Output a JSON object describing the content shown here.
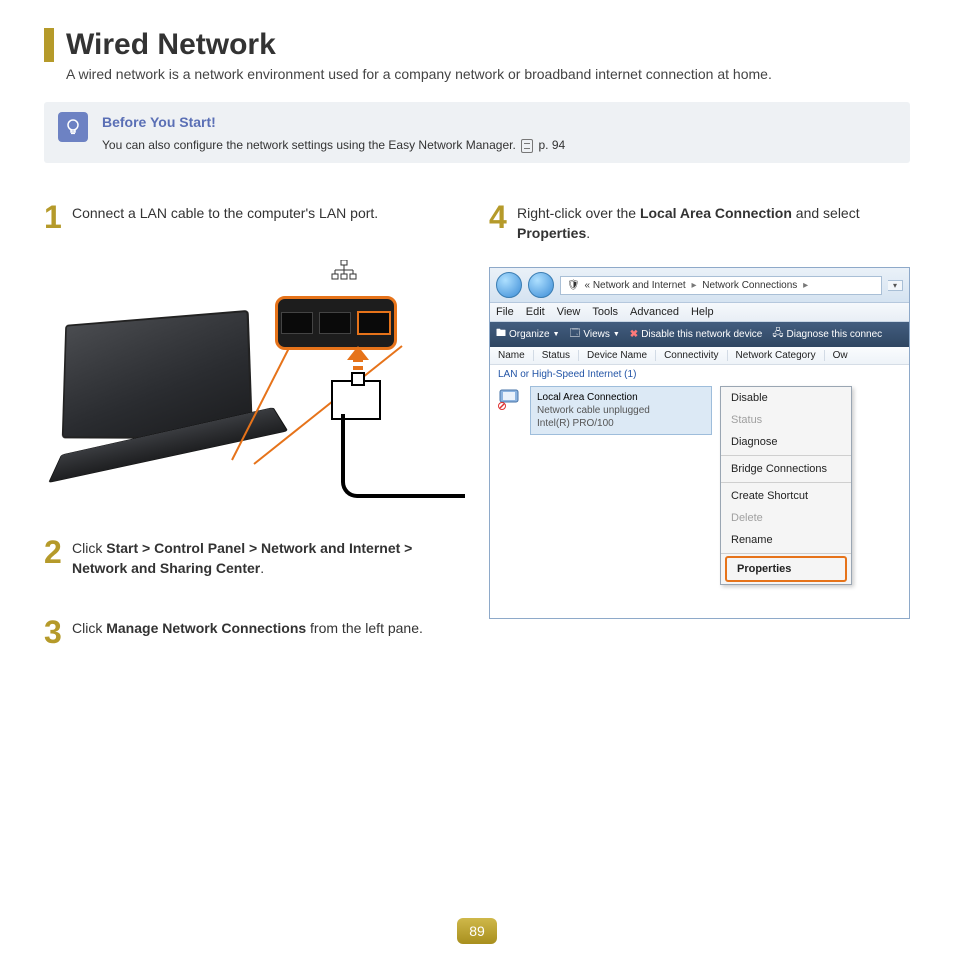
{
  "title": "Wired Network",
  "subtitle": "A wired network is a network environment used for a company network or broadband internet connection at home.",
  "callout": {
    "title": "Before You Start!",
    "text_pre": "You can also configure the network settings using the Easy Network Manager. ",
    "page_ref": "p. 94"
  },
  "steps": {
    "s1": {
      "num": "1",
      "text": "Connect a LAN cable to the computer's LAN port."
    },
    "s2": {
      "num": "2",
      "prefix": "Click ",
      "path": "Start > Control Panel > Network and Internet > Network and Sharing Center",
      "suffix": "."
    },
    "s3": {
      "num": "3",
      "prefix": "Click ",
      "bold": "Manage Network Connections",
      "suffix": " from the left pane."
    },
    "s4": {
      "num": "4",
      "prefix": "Right-click over the ",
      "bold1": "Local Area Connection",
      "mid": " and select ",
      "bold2": "Properties",
      "suffix": "."
    }
  },
  "window": {
    "breadcrumb": {
      "p1": "Network and Internet",
      "p2": "Network Connections",
      "sep": "▸"
    },
    "menu": [
      "File",
      "Edit",
      "View",
      "Tools",
      "Advanced",
      "Help"
    ],
    "toolbar": {
      "organize": "Organize",
      "views": "Views",
      "disable": "Disable this network device",
      "diagnose": "Diagnose this connec"
    },
    "columns": [
      "Name",
      "Status",
      "Device Name",
      "Connectivity",
      "Network Category",
      "Ow"
    ],
    "section": "LAN or High-Speed Internet (1)",
    "connection": {
      "name": "Local Area Connection",
      "status": "Network cable unplugged",
      "device": "Intel(R) PRO/100"
    },
    "context_menu": {
      "disable": "Disable",
      "status": "Status",
      "diagnose": "Diagnose",
      "bridge": "Bridge Connections",
      "shortcut": "Create Shortcut",
      "delete": "Delete",
      "rename": "Rename",
      "properties": "Properties"
    }
  },
  "page_number": "89"
}
